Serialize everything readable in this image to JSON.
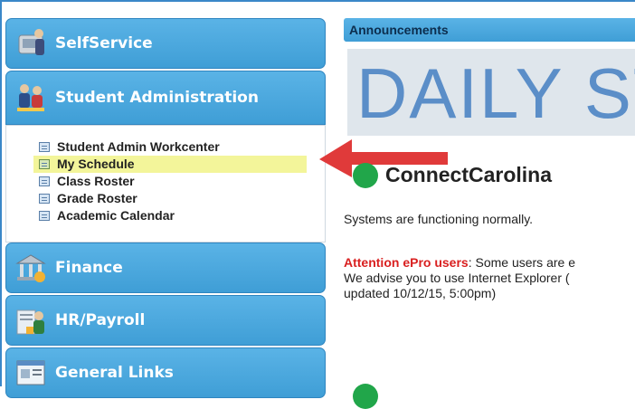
{
  "sidebar": {
    "sections": {
      "self_service": {
        "label": "SelfService",
        "icon": "self-service-icon"
      },
      "student_admin": {
        "label": "Student Administration",
        "icon": "student-administration-icon"
      },
      "finance": {
        "label": "Finance",
        "icon": "finance-building-icon"
      },
      "hr_payroll": {
        "label": "HR/Payroll",
        "icon": "hr-payroll-icon"
      },
      "general_links": {
        "label": "General Links",
        "icon": "general-links-icon"
      }
    },
    "student_admin_links": [
      {
        "label": "Student Admin Workcenter",
        "highlighted": false
      },
      {
        "label": "My Schedule",
        "highlighted": true
      },
      {
        "label": "Class Roster",
        "highlighted": false
      },
      {
        "label": "Grade Roster",
        "highlighted": false
      },
      {
        "label": "Academic Calendar",
        "highlighted": false
      }
    ]
  },
  "announcements": {
    "header": "Announcements",
    "banner_text": "DAILY STA",
    "system": {
      "name": "ConnectCarolina",
      "status": "Systems are functioning normally.",
      "status_color": "#21a64a"
    },
    "notice": {
      "lead": "Attention ePro users",
      "text": ": Some users are e",
      "line2": "We advise you to use Internet Explorer (",
      "line3": "updated 10/12/15, 5:00pm)"
    }
  },
  "colors": {
    "header_blue": "#4aa8de",
    "highlight_yellow": "#f3f59a",
    "arrow_red": "#e03a3a"
  }
}
